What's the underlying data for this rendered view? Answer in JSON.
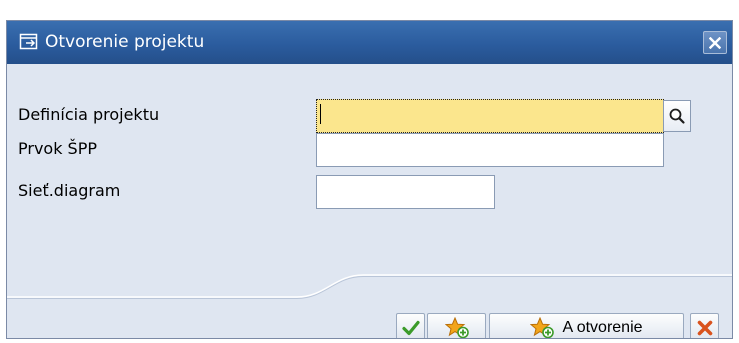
{
  "dialog": {
    "title": "Otvorenie projektu",
    "close_label": "Close"
  },
  "fields": [
    {
      "label": "Definícia projektu",
      "value": "",
      "focused": true,
      "has_search_help": true
    },
    {
      "label": "Prvok ŠPP",
      "value": "",
      "focused": false,
      "has_search_help": false
    },
    {
      "label": "Sieť.diagram",
      "value": "",
      "focused": false,
      "has_search_help": false
    }
  ],
  "footer": {
    "buttons": [
      {
        "name": "continue-button",
        "icon": "checkmark-icon",
        "label": ""
      },
      {
        "name": "create-button",
        "icon": "star-add-icon",
        "label": ""
      },
      {
        "name": "create-and-open-button",
        "icon": "star-add-icon",
        "label": "A otvorenie"
      },
      {
        "name": "cancel-button",
        "icon": "x-icon",
        "label": ""
      }
    ]
  },
  "colors": {
    "title_bar": "#2b5c9e",
    "dialog_background": "#dfe6f1",
    "focused_field": "#fbe68d",
    "confirm_green": "#3c9b2a",
    "cancel_red": "#d9531e",
    "star_orange": "#f2a51a"
  }
}
